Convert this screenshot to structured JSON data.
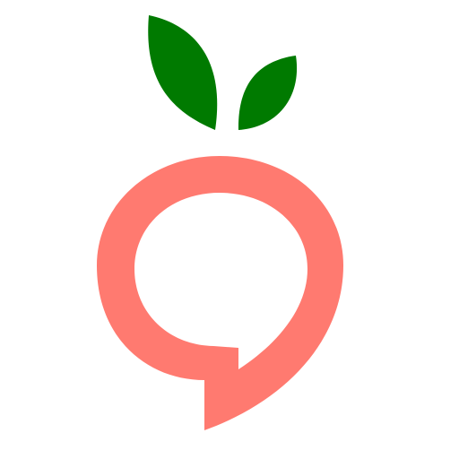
{
  "app_icon": {
    "icon": "peach-speech-bubble-icon",
    "colors": {
      "bubble": "#FF7A70",
      "leaf": "#007A00",
      "background": "#FFFFFF"
    }
  }
}
